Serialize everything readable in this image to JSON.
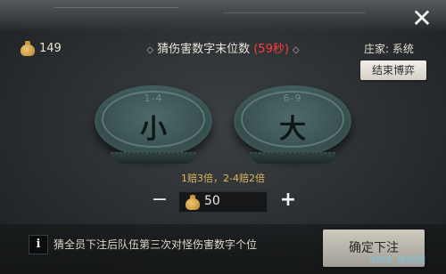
{
  "header": {
    "close_icon": "close-icon",
    "currency": {
      "icon": "money-bag-icon",
      "amount": "149"
    },
    "title": "猜伤害数字末位数",
    "timer": "(59秒)",
    "dealer": "庄家: 系统",
    "end_button": "结束博弈"
  },
  "plates": [
    {
      "range": "1-4",
      "label": "小"
    },
    {
      "range": "6-9",
      "label": "大"
    }
  ],
  "odds_text": "1赔3倍，2-4赔2倍",
  "bet": {
    "minus": "−",
    "plus": "+",
    "icon": "money-bag-icon",
    "value": "50"
  },
  "footer": {
    "info_icon": "i",
    "info_text": "猜全员下注后队伍第三次对怪伤害数字个位",
    "confirm_button": "确定下注"
  },
  "watermark": "9ME 游戏网",
  "colors": {
    "timer": "#ff3c3c",
    "odds": "#e0b75e",
    "plate": "#3b5353"
  }
}
